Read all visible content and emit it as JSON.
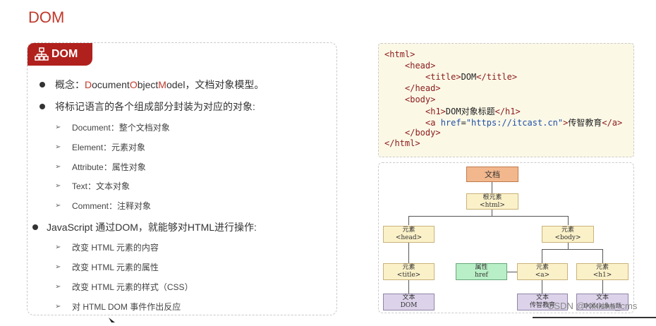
{
  "slide": {
    "title": "DOM"
  },
  "section_tag": {
    "label": "DOM",
    "icon": "hierarchy-icon"
  },
  "bullets": [
    {
      "prefix": "概念：",
      "parts": [
        "D",
        "ocument ",
        "O",
        "bject ",
        "M",
        "odel"
      ],
      "suffix": "，文档对象模型。"
    },
    {
      "text": "将标记语言的各个组成部分封装为对应的对象:"
    },
    {
      "text": "JavaScript 通过DOM，就能够对HTML进行操作:"
    }
  ],
  "objects": [
    "Document：整个文档对象",
    "Element：元素对象",
    "Attribute：属性对象",
    "Text：文本对象",
    "Comment：注释对象"
  ],
  "operations": [
    "改变 HTML 元素的内容",
    "改变 HTML 元素的属性",
    "改变 HTML 元素的样式（CSS）",
    "对 HTML DOM 事件作出反应"
  ],
  "code": {
    "l1": "<html>",
    "l2": "<head>",
    "l3_open": "<title>",
    "l3_text": "DOM",
    "l3_close": "</title>",
    "l4": "</head>",
    "l5": "<body>",
    "l6_open": "<h1>",
    "l6_text": "DOM对象标题",
    "l6_close": "</h1>",
    "l7_a": "<a ",
    "l7_attr": "href",
    "l7_eq": "=",
    "l7_val": "\"https://itcast.cn\"",
    "l7_gt": ">",
    "l7_text": "传智教育",
    "l7_close": "</a>",
    "l8": "</body>",
    "l9": "</html>"
  },
  "tree": {
    "doc": "文档",
    "root": {
      "a": "根元素",
      "b": "<html>"
    },
    "head": {
      "a": "元素",
      "b": "<head>"
    },
    "body": {
      "a": "元素",
      "b": "<body>"
    },
    "title": {
      "a": "元素",
      "b": "<title>"
    },
    "attr": {
      "a": "属性",
      "b": "href"
    },
    "anchor": {
      "a": "元素",
      "b": "<a>"
    },
    "h1": {
      "a": "元素",
      "b": "<h1>"
    },
    "text_dom": {
      "a": "文本",
      "b": "DOM"
    },
    "text_itcast": {
      "a": "文本",
      "b": "传智教育"
    },
    "text_h1": {
      "a": "文本",
      "b": "DOM对象标题"
    }
  },
  "watermark": "CSDN @Nikisha_cms"
}
